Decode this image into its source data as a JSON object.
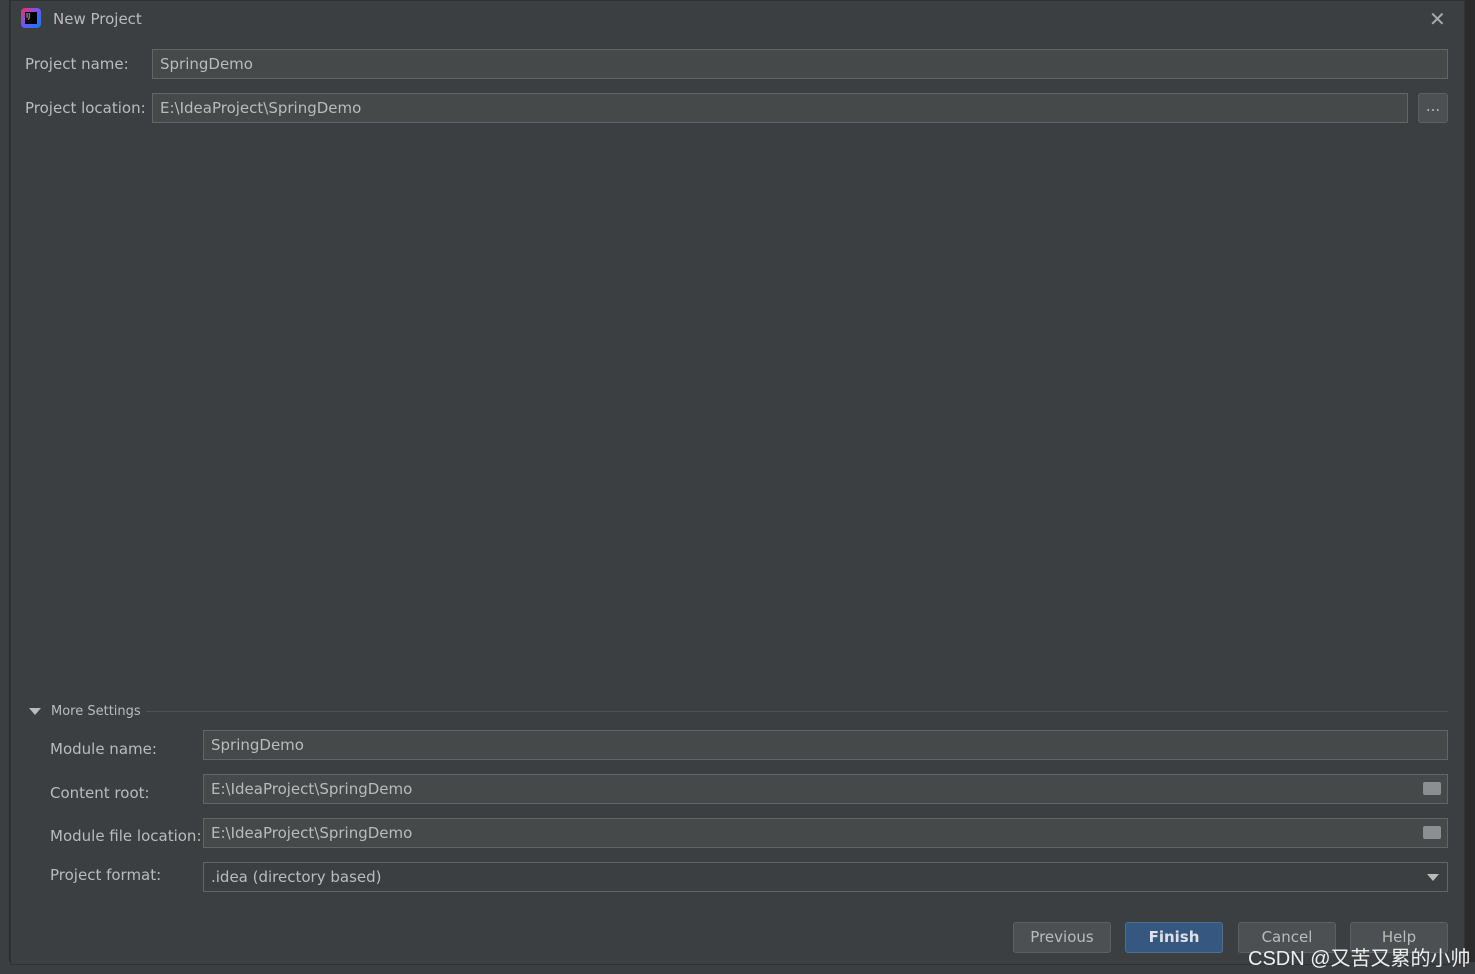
{
  "dialog": {
    "title": "New Project",
    "close_icon": "close-icon",
    "logo": "intellij-idea-logo"
  },
  "project_name": {
    "label": "Project name:",
    "value": "SpringDemo"
  },
  "project_location": {
    "label": "Project location:",
    "value": "E:\\IdeaProject\\SpringDemo",
    "browse_label": "..."
  },
  "more_settings": {
    "label": "More Settings",
    "expanded": true,
    "module_name": {
      "label": "Module name:",
      "value": "SpringDemo"
    },
    "content_root": {
      "label": "Content root:",
      "value": "E:\\IdeaProject\\SpringDemo"
    },
    "module_file_location": {
      "label": "Module file location:",
      "value": "E:\\IdeaProject\\SpringDemo"
    },
    "project_format": {
      "label": "Project format:",
      "value": ".idea (directory based)"
    }
  },
  "buttons": {
    "previous": "Previous",
    "finish": "Finish",
    "cancel": "Cancel",
    "help": "Help"
  },
  "watermark": "CSDN @又苦又累的小帅"
}
